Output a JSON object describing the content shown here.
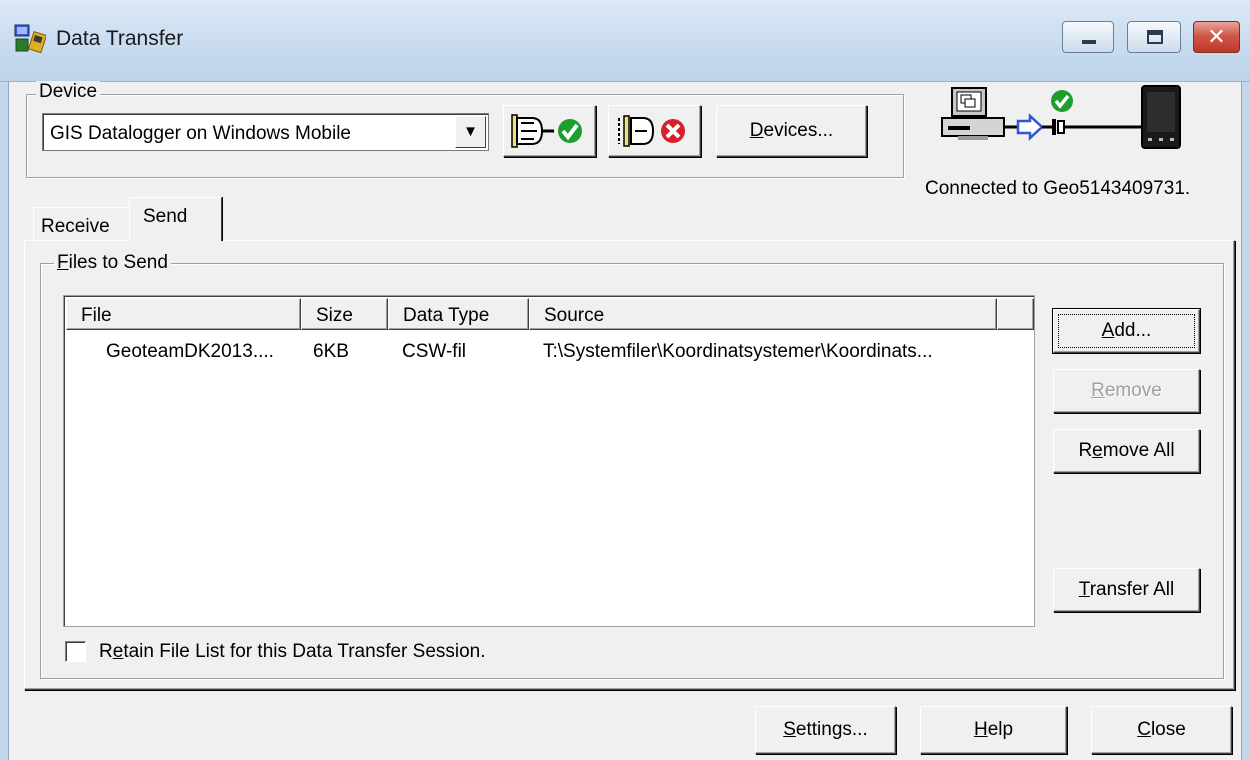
{
  "window": {
    "title": "Data Transfer"
  },
  "device": {
    "group_label": "Device",
    "selected": "GIS Datalogger on Windows Mobile",
    "devices_button": {
      "mnemonic": "D",
      "rest": "evices..."
    }
  },
  "status": {
    "text": "Connected to Geo5143409731."
  },
  "tabs": [
    {
      "label": "Receive"
    },
    {
      "label": "Send"
    }
  ],
  "files_group": {
    "mnemonic": "F",
    "rest": "iles to Send"
  },
  "file_list": {
    "columns": [
      "File",
      "Size",
      "Data Type",
      "Source"
    ],
    "rows": [
      {
        "file": "GeoteamDK2013....",
        "size": "6KB",
        "type": "CSW-fil",
        "source": "T:\\Systemfiler\\Koordinatsystemer\\Koordinats..."
      }
    ]
  },
  "actions": {
    "add": {
      "mnemonic": "A",
      "rest": "dd..."
    },
    "remove": {
      "mnemonic": "R",
      "rest": "emove"
    },
    "remove_all": {
      "pre": "R",
      "mnemonic": "e",
      "rest": "move All"
    },
    "transfer_all": {
      "mnemonic": "T",
      "rest": "ransfer All"
    }
  },
  "retain": {
    "pre": "R",
    "mnemonic": "e",
    "rest": "tain File List for this Data Transfer Session."
  },
  "bottom": {
    "settings": {
      "mnemonic": "S",
      "rest": "ettings..."
    },
    "help": {
      "mnemonic": "H",
      "rest": "elp"
    },
    "close": {
      "mnemonic": "C",
      "rest": "lose"
    }
  },
  "colors": {
    "connected_green": "#1e9e2e",
    "disconnect_red": "#d6202a",
    "arrow_blue": "#2f57d4"
  },
  "icons": {
    "app": "data-transfer-icon",
    "connect": "connect-check-icon",
    "disconnect": "disconnect-x-icon",
    "connection": "computer-to-handheld-connected-icon"
  }
}
